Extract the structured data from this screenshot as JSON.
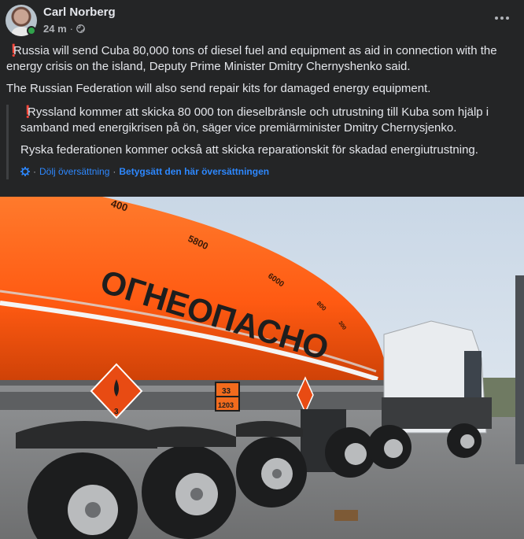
{
  "post": {
    "author": "Carl Norberg",
    "time": "24 m",
    "separator": "·",
    "original_paragraphs": [
      "Russia will send Cuba 80,000 tons of diesel fuel and equipment as aid in connection with the energy crisis on the island, Deputy Prime Minister Dmitry Chernyshenko said.",
      "The Russian Federation will also send repair kits for damaged energy equipment."
    ],
    "translated_paragraphs": [
      "Ryssland kommer att skicka 80 000 ton dieselbränsle och utrustning till Kuba som hjälp i samband med energikrisen på ön, säger vice premiärminister Dmitry Chernysjenko.",
      "Ryska federationen kommer också att skicka reparationskit för skadad energiutrustning."
    ],
    "exclaim_icon": "❗",
    "translation_footer": {
      "hide_label": "Dölj översättning",
      "rate_label": "Betygsätt den här översättningen",
      "separator": "·"
    }
  },
  "photo": {
    "tank_text": "ОГНЕОПАСНО",
    "volume_marks": [
      "400",
      "5800",
      "6000",
      "800",
      "300"
    ],
    "hazard_top": "33",
    "hazard_bottom": "1203",
    "diamond_number": "3"
  },
  "colors": {
    "background": "#242526",
    "text": "#e4e6eb",
    "muted": "#b0b3b8",
    "link": "#2d88ff",
    "exclaim": "#e0245e",
    "online": "#31a24c",
    "tank": "#ff5a12"
  },
  "icons": [
    "globe-icon",
    "more-icon",
    "gear-icon",
    "exclamation-icon"
  ]
}
